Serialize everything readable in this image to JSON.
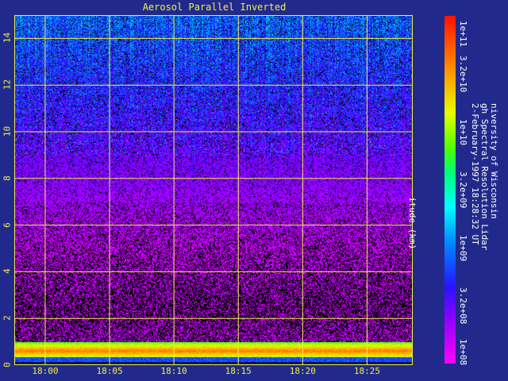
{
  "chart_data": {
    "type": "heatmap",
    "title": "Aerosol Parallel Inverted",
    "ylabel": "itude (km)",
    "ylim": [
      0,
      15
    ],
    "y_ticks": [
      "0",
      "2",
      "4",
      "6",
      "8",
      "10",
      "12",
      "14"
    ],
    "x_ticks": [
      "18:00",
      "18:05",
      "18:10",
      "18:15",
      "18:20",
      "18:25"
    ],
    "grid": true,
    "colorbar": {
      "scale": "log",
      "range": [
        100000000.0,
        100000000000.0
      ],
      "tick_labels": [
        "1e+08",
        "3.2e+08",
        "1e+09",
        "3.2e+09",
        "1e+10",
        "3.2e+10",
        "1e+11"
      ]
    },
    "annotation_lines": [
      "niversity of Wisconsin",
      "gh Spectral Resolution Lidar",
      "2-February-1997 18:28:32 UT"
    ]
  }
}
